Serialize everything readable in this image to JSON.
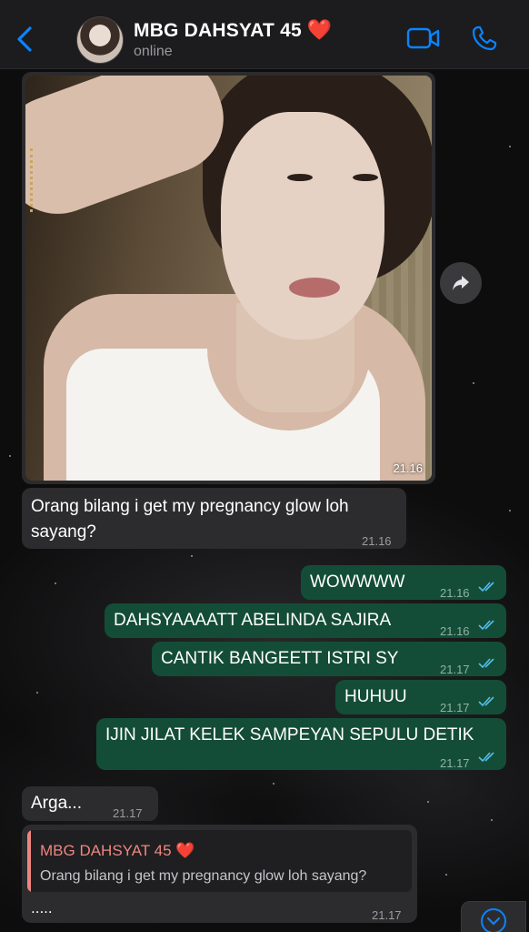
{
  "header": {
    "title": "MBG DAHSYAT 45",
    "heart": "❤️",
    "status": "online"
  },
  "messages": {
    "image_time": "21.16",
    "m1": {
      "text_line1": "Orang bilang i get my pregnancy glow loh",
      "text_line2": "sayang?",
      "time": "21.16"
    },
    "m2": {
      "text": "WOWWWW",
      "time": "21.16"
    },
    "m3": {
      "text": "DAHSYAAAATT ABELINDA SAJIRA",
      "time": "21.16"
    },
    "m4": {
      "text": "CANTIK BANGEETT ISTRI SY",
      "time": "21.17"
    },
    "m5": {
      "text": "HUHUU",
      "time": "21.17"
    },
    "m6": {
      "text": "IJIN JILAT KELEK SAMPEYAN SEPULU DETIK",
      "time": "21.17"
    },
    "m7": {
      "text": "Arga...",
      "time": "21.17"
    },
    "m8": {
      "quote_name": "MBG DAHSYAT 45",
      "quote_heart": "❤️",
      "quote_text": "Orang bilang i get my pregnancy glow loh sayang?",
      "text": ".....",
      "time": "21.17"
    }
  },
  "colors": {
    "accent": "#0a84ff",
    "incoming_bubble": "#2c2c2e",
    "outgoing_bubble": "#144d37",
    "read_ticks": "#53bdeb",
    "quote_name": "#ee8680"
  },
  "icons": [
    "back-chevron-icon",
    "video-call-icon",
    "phone-call-icon",
    "forward-icon",
    "double-check-icon",
    "chevron-down-icon"
  ]
}
